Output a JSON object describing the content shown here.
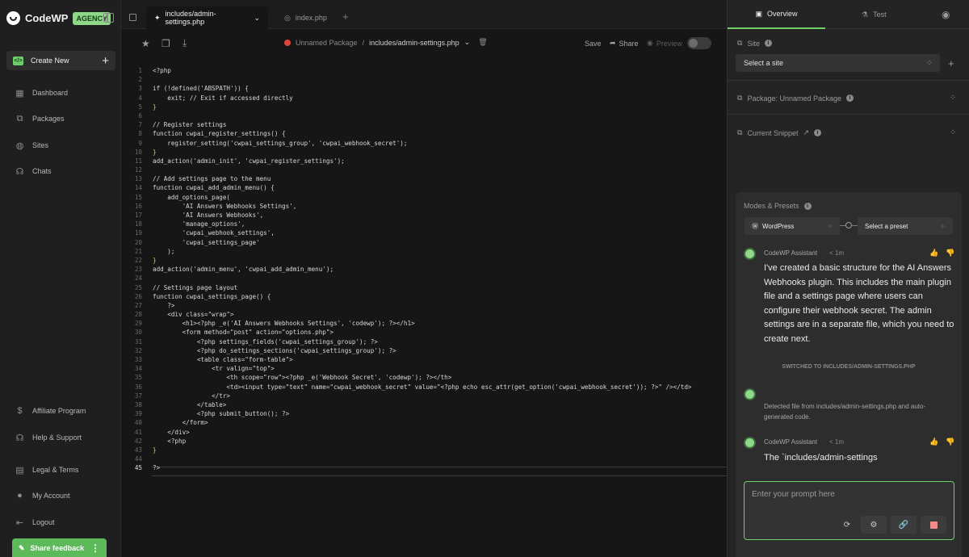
{
  "sidebar": {
    "brand": "CodeWP",
    "badge": "AGENCY",
    "create_label": "Create New",
    "nav": [
      {
        "label": "Dashboard",
        "icon": "dashboard-icon"
      },
      {
        "label": "Packages",
        "icon": "packages-icon"
      },
      {
        "label": "Sites",
        "icon": "globe-icon"
      },
      {
        "label": "Chats",
        "icon": "headset-icon"
      }
    ],
    "bottom_nav": [
      {
        "label": "Affiliate Program",
        "icon": "dollar-icon"
      },
      {
        "label": "Help & Support",
        "icon": "headset-icon"
      },
      {
        "label": "Legal & Terms",
        "icon": "document-icon"
      },
      {
        "label": "My Account",
        "icon": "user-icon"
      },
      {
        "label": "Logout",
        "icon": "logout-icon"
      }
    ],
    "feedback_label": "Share feedback"
  },
  "tabs": [
    {
      "label": "includes/admin-settings.php",
      "active": true
    },
    {
      "label": "index.php",
      "active": false
    }
  ],
  "toolbar": {
    "package_name": "Unnamed Package",
    "separator": "/",
    "file_path": "includes/admin-settings.php",
    "save_label": "Save",
    "share_label": "Share",
    "preview_label": "Preview"
  },
  "code": {
    "current_line": 45,
    "lines": [
      "<?php",
      "",
      "if (!defined('ABSPATH')) {",
      "    exit; // Exit if accessed directly",
      "}",
      "",
      "// Register settings",
      "function cwpai_register_settings() {",
      "    register_setting('cwpai_settings_group', 'cwpai_webhook_secret');",
      "}",
      "add_action('admin_init', 'cwpai_register_settings');",
      "",
      "// Add settings page to the menu",
      "function cwpai_add_admin_menu() {",
      "    add_options_page(",
      "        'AI Answers Webhooks Settings',",
      "        'AI Answers Webhooks',",
      "        'manage_options',",
      "        'cwpai_webhook_settings',",
      "        'cwpai_settings_page'",
      "    );",
      "}",
      "add_action('admin_menu', 'cwpai_add_admin_menu');",
      "",
      "// Settings page layout",
      "function cwpai_settings_page() {",
      "    ?>",
      "    <div class=\"wrap\">",
      "        <h1><?php _e('AI Answers Webhooks Settings', 'codewp'); ?></h1>",
      "        <form method=\"post\" action=\"options.php\">",
      "            <?php settings_fields('cwpai_settings_group'); ?>",
      "            <?php do_settings_sections('cwpai_settings_group'); ?>",
      "            <table class=\"form-table\">",
      "                <tr valign=\"top\">",
      "                    <th scope=\"row\"><?php _e('Webhook Secret', 'codewp'); ?></th>",
      "                    <td><input type=\"text\" name=\"cwpai_webhook_secret\" value=\"<?php echo esc_attr(get_option('cwpai_webhook_secret')); ?>\" /></td>",
      "                </tr>",
      "            </table>",
      "            <?php submit_button(); ?>",
      "        </form>",
      "    </div>",
      "    <?php",
      "}",
      "",
      "?>"
    ]
  },
  "right_panel": {
    "tabs": {
      "overview": "Overview",
      "test": "Test"
    },
    "site_label": "Site",
    "site_select": "Select a site",
    "package_label": "Package: Unnamed Package",
    "snippet_label": "Current Snippet",
    "modes_label": "Modes & Presets",
    "mode_value": "WordPress",
    "preset_value": "Select a preset",
    "messages": [
      {
        "author": "CodeWP Assistant",
        "time": "< 1m",
        "text": "I've created a basic structure for the AI Answers Webhooks plugin. This includes the main plugin file and a settings page where users can configure their webhook secret. The admin settings are in a separate file, which you need to create next."
      },
      {
        "author": "",
        "time": "",
        "text": "Detected file from includes/admin-settings.php and auto-generated code."
      },
      {
        "author": "CodeWP Assistant",
        "time": "< 1m",
        "text": "The `includes/admin-settings"
      }
    ],
    "switch_note": "SWITCHED TO INCLUDES/ADMIN-SETTINGS.PHP",
    "prompt_placeholder": "Enter your prompt here"
  },
  "colors": {
    "accent": "#6ccf6a",
    "badge": "#8fd88a",
    "status_dot": "#e0443f"
  }
}
